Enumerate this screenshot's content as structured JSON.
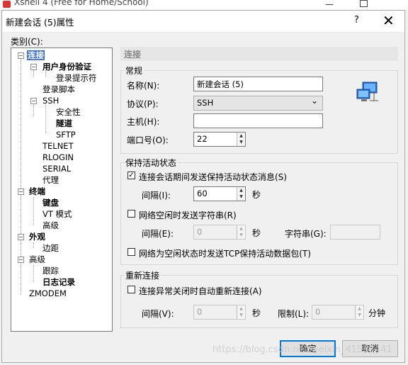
{
  "background_window": {
    "title": "Xshell 4 (Free for Home/School)"
  },
  "dialog": {
    "title": "新建会话 (5)属性",
    "help": "?",
    "close": "✕"
  },
  "category_label": "类别(C):",
  "tree": {
    "connection": "连接",
    "auth": "用户身份验证",
    "login_prompt": "登录提示符",
    "login_script": "登录脚本",
    "ssh": "SSH",
    "security": "安全性",
    "tunnel": "隧道",
    "sftp": "SFTP",
    "telnet": "TELNET",
    "rlogin": "RLOGIN",
    "serial": "SERIAL",
    "proxy": "代理",
    "terminal": "终端",
    "keyboard": "键盘",
    "vt_mode": "VT 模式",
    "advanced1": "高级",
    "appearance": "外观",
    "margin": "边距",
    "advanced2": "高级",
    "trace": "跟踪",
    "logging": "日志记录",
    "zmodem": "ZMODEM",
    "expander_minus": "−"
  },
  "section_header": "连接",
  "general": {
    "title": "常规",
    "name_label": "名称(N):",
    "name_value": "新建会话 (5)",
    "protocol_label": "协议(P):",
    "protocol_value": "SSH",
    "host_label": "主机(H):",
    "host_value": "",
    "port_label": "端口号(O):",
    "port_value": "22"
  },
  "keepalive": {
    "title": "保持活动状态",
    "send_label": "连接会话期间发送保持活动状态消息(S)",
    "interval_label": "间隔(I):",
    "interval_value": "60",
    "interval_unit": "秒",
    "string_label": "网络空闲时发送字符串(R)",
    "interval2_label": "间隔(E):",
    "interval2_value": "0",
    "interval2_unit": "秒",
    "string_field_label": "字符串(G):",
    "tcp_label": "网络为空闲状态时发送TCP保持活动数据包(T)",
    "check_mark": "✓"
  },
  "reconnect": {
    "title": "重新连接",
    "auto_label": "连接异常关闭时自动重新连接(A)",
    "interval_label": "间隔(V):",
    "interval_value": "0",
    "interval_unit": "秒",
    "limit_label": "限制(L):",
    "limit_value": "0",
    "limit_unit": "分钟"
  },
  "buttons": {
    "ok": "确定",
    "cancel": "取消"
  },
  "watermark": "https://blog.csdn.net/weixin_41568441",
  "spin": {
    "up": "▲",
    "down": "▼"
  },
  "arrow": "⌄"
}
